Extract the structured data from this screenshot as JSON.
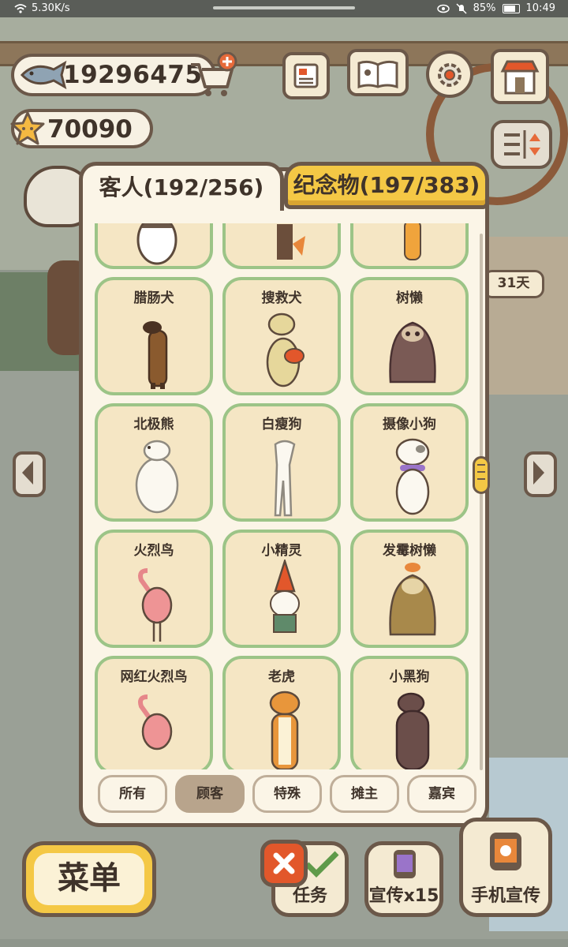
{
  "status_bar": {
    "speed": "5.30K/s",
    "battery": "85%",
    "time": "10:49"
  },
  "currency": {
    "fish": "19296475",
    "stars": "70090"
  },
  "background": {
    "days_tag": "31天"
  },
  "tabs": {
    "guests": "客人(192/256)",
    "souvenirs": "纪念物(197/383)"
  },
  "cards": [
    {
      "label": ""
    },
    {
      "label": ""
    },
    {
      "label": ""
    },
    {
      "label": "腊肠犬"
    },
    {
      "label": "搜救犬"
    },
    {
      "label": "树懒"
    },
    {
      "label": "北极熊"
    },
    {
      "label": "白瘦狗"
    },
    {
      "label": "摄像小狗"
    },
    {
      "label": "火烈鸟"
    },
    {
      "label": "小精灵"
    },
    {
      "label": "发霉树懒"
    },
    {
      "label": "网红火烈鸟"
    },
    {
      "label": "老虎"
    },
    {
      "label": "小黑狗"
    }
  ],
  "filters": {
    "all": "所有",
    "customer": "顾客",
    "special": "特殊",
    "vendor": "摊主",
    "guest": "嘉宾"
  },
  "bottom": {
    "menu": "菜单",
    "tasks": "任务",
    "promote": "宣传x15",
    "phone_promote": "手机宣传"
  },
  "colors": {
    "panel_border": "#6b5849",
    "card_border": "#9cc487",
    "card_bg": "#f5e6c4",
    "accent_yellow": "#f4c845",
    "close_red": "#e2572b"
  },
  "icons": [
    "wifi-icon",
    "eye-icon",
    "mute-icon",
    "battery-icon",
    "fish-icon",
    "cart-add-icon",
    "star-icon",
    "newspaper-icon",
    "recipe-book-icon",
    "settings-gear-icon",
    "shop-icon",
    "layout-toggle-icon",
    "arrow-left-icon",
    "arrow-right-icon",
    "close-icon",
    "task-check-icon",
    "promo-phone-icon"
  ]
}
